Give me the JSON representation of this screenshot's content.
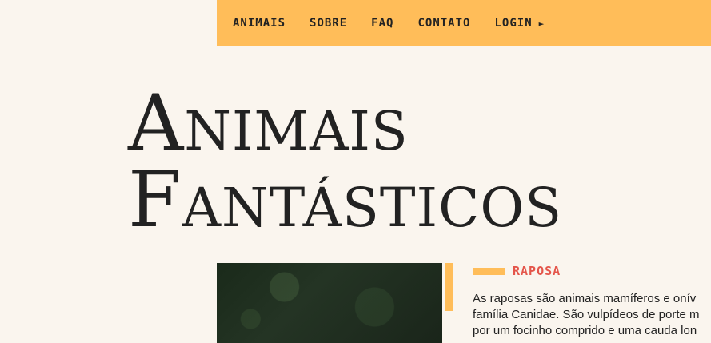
{
  "nav": {
    "items": [
      {
        "label": "ANIMAIS"
      },
      {
        "label": "SOBRE"
      },
      {
        "label": "FAQ"
      },
      {
        "label": "CONTATO"
      },
      {
        "label": "LOGIN"
      }
    ],
    "login_caret": "►"
  },
  "hero": {
    "title_line1": "Animais",
    "title_line2": "Fantásticos"
  },
  "card": {
    "image_alt": "raposa",
    "title": "RAPOSA",
    "text_lines": [
      "As raposas são animais mamíferos e onív",
      "família Canidae. São vulpídeos de porte m",
      "por um focinho comprido e uma cauda lon"
    ]
  },
  "colors": {
    "accent": "#ffbd59",
    "title_red": "#e4554a",
    "background": "#faf5ee"
  }
}
